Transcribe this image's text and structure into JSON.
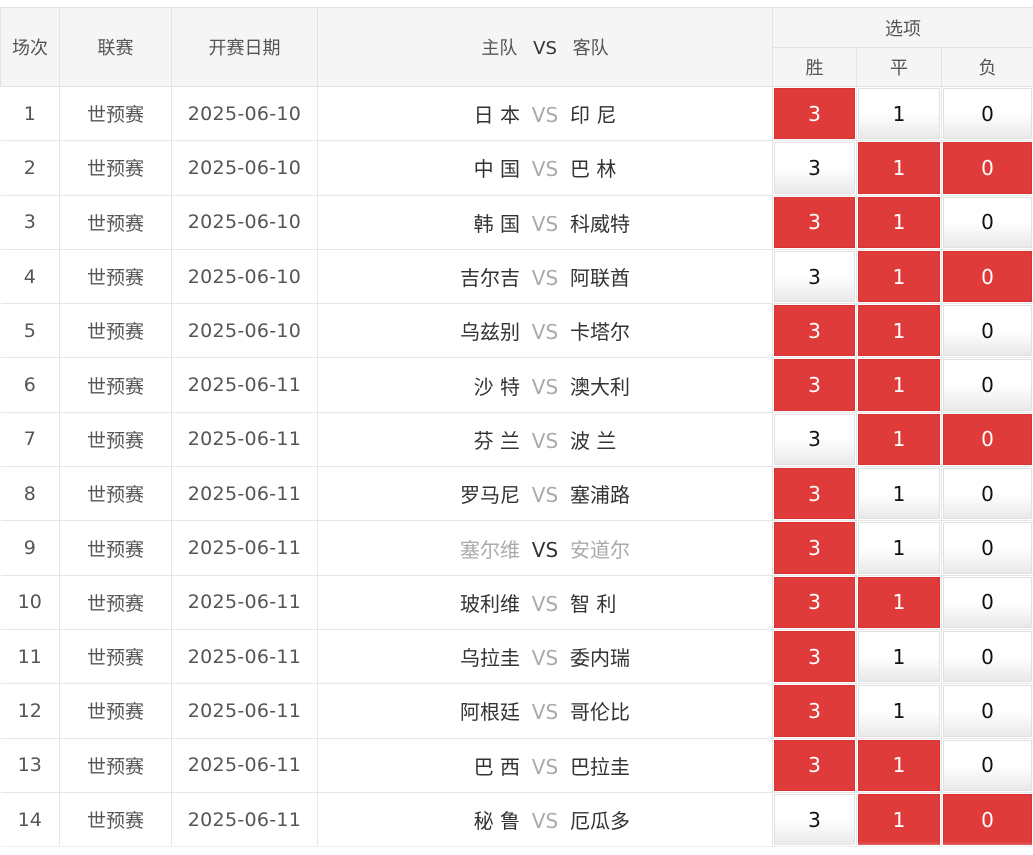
{
  "header": {
    "index": "场次",
    "league": "联赛",
    "date": "开赛日期",
    "home": "主队",
    "vs": "VS",
    "away": "客队",
    "options": "选项",
    "win": "胜",
    "draw": "平",
    "lose": "负"
  },
  "colors": {
    "selected": "#e03b3b",
    "header_bg": "#f5f5f5"
  },
  "matches": [
    {
      "idx": "1",
      "league": "世预赛",
      "date": "2025-06-10",
      "home": "日 本",
      "away": "印 尼",
      "w": "3",
      "d": "1",
      "l": "0",
      "sel": [
        true,
        false,
        false
      ],
      "dim": false
    },
    {
      "idx": "2",
      "league": "世预赛",
      "date": "2025-06-10",
      "home": "中 国",
      "away": "巴 林",
      "w": "3",
      "d": "1",
      "l": "0",
      "sel": [
        false,
        true,
        true
      ],
      "dim": false
    },
    {
      "idx": "3",
      "league": "世预赛",
      "date": "2025-06-10",
      "home": "韩 国",
      "away": "科威特",
      "w": "3",
      "d": "1",
      "l": "0",
      "sel": [
        true,
        true,
        false
      ],
      "dim": false
    },
    {
      "idx": "4",
      "league": "世预赛",
      "date": "2025-06-10",
      "home": "吉尔吉",
      "away": "阿联酋",
      "w": "3",
      "d": "1",
      "l": "0",
      "sel": [
        false,
        true,
        true
      ],
      "dim": false
    },
    {
      "idx": "5",
      "league": "世预赛",
      "date": "2025-06-10",
      "home": "乌兹别",
      "away": "卡塔尔",
      "w": "3",
      "d": "1",
      "l": "0",
      "sel": [
        true,
        true,
        false
      ],
      "dim": false
    },
    {
      "idx": "6",
      "league": "世预赛",
      "date": "2025-06-11",
      "home": "沙 特",
      "away": "澳大利",
      "w": "3",
      "d": "1",
      "l": "0",
      "sel": [
        true,
        true,
        false
      ],
      "dim": false
    },
    {
      "idx": "7",
      "league": "世预赛",
      "date": "2025-06-11",
      "home": "芬 兰",
      "away": "波 兰",
      "w": "3",
      "d": "1",
      "l": "0",
      "sel": [
        false,
        true,
        true
      ],
      "dim": false
    },
    {
      "idx": "8",
      "league": "世预赛",
      "date": "2025-06-11",
      "home": "罗马尼",
      "away": "塞浦路",
      "w": "3",
      "d": "1",
      "l": "0",
      "sel": [
        true,
        false,
        false
      ],
      "dim": false
    },
    {
      "idx": "9",
      "league": "世预赛",
      "date": "2025-06-11",
      "home": "塞尔维",
      "away": "安道尔",
      "w": "3",
      "d": "1",
      "l": "0",
      "sel": [
        true,
        false,
        false
      ],
      "dim": true
    },
    {
      "idx": "10",
      "league": "世预赛",
      "date": "2025-06-11",
      "home": "玻利维",
      "away": "智 利",
      "w": "3",
      "d": "1",
      "l": "0",
      "sel": [
        true,
        true,
        false
      ],
      "dim": false
    },
    {
      "idx": "11",
      "league": "世预赛",
      "date": "2025-06-11",
      "home": "乌拉圭",
      "away": "委内瑞",
      "w": "3",
      "d": "1",
      "l": "0",
      "sel": [
        true,
        false,
        false
      ],
      "dim": false
    },
    {
      "idx": "12",
      "league": "世预赛",
      "date": "2025-06-11",
      "home": "阿根廷",
      "away": "哥伦比",
      "w": "3",
      "d": "1",
      "l": "0",
      "sel": [
        true,
        false,
        false
      ],
      "dim": false
    },
    {
      "idx": "13",
      "league": "世预赛",
      "date": "2025-06-11",
      "home": "巴 西",
      "away": "巴拉圭",
      "w": "3",
      "d": "1",
      "l": "0",
      "sel": [
        true,
        true,
        false
      ],
      "dim": false
    },
    {
      "idx": "14",
      "league": "世预赛",
      "date": "2025-06-11",
      "home": "秘 鲁",
      "away": "厄瓜多",
      "w": "3",
      "d": "1",
      "l": "0",
      "sel": [
        false,
        true,
        true
      ],
      "dim": false
    }
  ]
}
